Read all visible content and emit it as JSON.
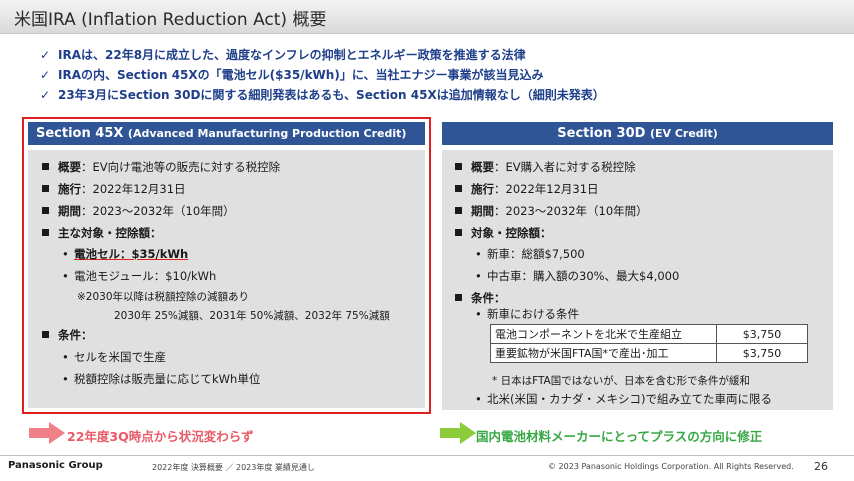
{
  "slide": {
    "title": "米国IRA (Inflation Reduction Act) 概要",
    "check_glyph": "✓",
    "bullets": [
      "IRAは、22年8月に成立した、過度なインフレの抑制とエネルギー政策を推進する法律",
      "IRAの内、Section 45Xの「電池セル($35/kWh)」に、当社エナジー事業が該当見込み",
      "23年3月にSection 30Dに関する細則発表はあるも、Section 45Xは追加情報なし（細則未発表）"
    ]
  },
  "left_panel": {
    "header": "Section 45X",
    "header_sub": "(Advanced Manufacturing Production Credit)",
    "rows": {
      "overview_key": "概要",
      "overview_val": "：EV向け電池等の販売に対する税控除",
      "start_key": "施行",
      "start_val": "：2022年12月31日",
      "period_key": "期間",
      "period_val": "：2023～2032年（10年間）",
      "targets_key": "主な対象・控除額",
      "targets_colon": "：",
      "cell": "電池セル：$35/kWh",
      "module": "電池モジュール：$10/kWh",
      "note1": "※2030年以降は税額控除の減額あり",
      "note2": "2030年 25%減額、2031年 50%減額、2032年 75%減額",
      "cond_key": "条件",
      "cond_colon": "：",
      "cond1": "セルを米国で生産",
      "cond2": "税額控除は販売量に応じてkWh単位"
    }
  },
  "right_panel": {
    "header": "Section 30D",
    "header_sub": "(EV Credit)",
    "rows": {
      "overview_key": "概要",
      "overview_val": "：EV購入者に対する税控除",
      "start_key": "施行",
      "start_val": "：2022年12月31日",
      "period_key": "期間",
      "period_val": "：2023～2032年（10年間）",
      "targets_key": "対象・控除額",
      "targets_colon": "：",
      "new_car": "新車：総額$7,500",
      "used_car": "中古車：購入額の30%、最大$4,000",
      "cond_key": "条件",
      "cond_colon": "：",
      "new_car_cond": "新車における条件",
      "table": [
        {
          "name": "電池コンポーネントを北米で生産組立",
          "value": "$3,750"
        },
        {
          "name": "重要鉱物が米国FTA国*で産出･加工",
          "value": "$3,750"
        }
      ],
      "footnote": "* 日本はFTA国ではないが、日本を含む形で条件が緩和",
      "north_america": "北米(米国・カナダ・メキシコ)で組み立てた車両に限る"
    }
  },
  "results": {
    "left": "22年度3Q時点から状況変わらず",
    "right": "国内電池材料メーカーにとってプラスの方向に修正",
    "left_arrow_color": "#f08088",
    "right_arrow_color": "#8ccc3a"
  },
  "footer": {
    "brand": "Panasonic Group",
    "subtitle": "2022年度 決算概要 ／ 2023年度 業績見通し",
    "copyright": "© 2023 Panasonic Holdings Corporation. All Rights Reserved.",
    "page": "26"
  },
  "colors": {
    "header_blue": "#2f5597",
    "frame_red": "#e02020",
    "bullet_blue": "#1f3f8a"
  }
}
